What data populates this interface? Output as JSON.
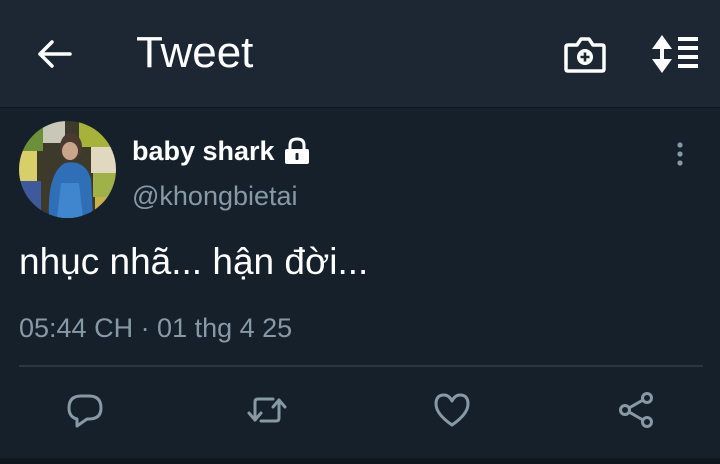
{
  "header": {
    "title": "Tweet",
    "back_icon": "arrow-left-icon",
    "camera_icon": "camera-plus-icon",
    "sort_icon": "sort-list-icon"
  },
  "tweet": {
    "display_name": "baby shark",
    "handle": "@khongbietai",
    "protected_icon": "lock-icon",
    "text": "nhục nhã... hận đời...",
    "timestamp": "05:44 CH · 01 thg 4 25"
  },
  "actions": [
    {
      "icon": "reply-icon"
    },
    {
      "icon": "retweet-icon"
    },
    {
      "icon": "like-heart-icon"
    },
    {
      "icon": "share-icon"
    }
  ],
  "colors": {
    "background": "#15202b",
    "header": "#1c2733",
    "text": "#ffffff",
    "secondary_text": "#8899a6"
  }
}
